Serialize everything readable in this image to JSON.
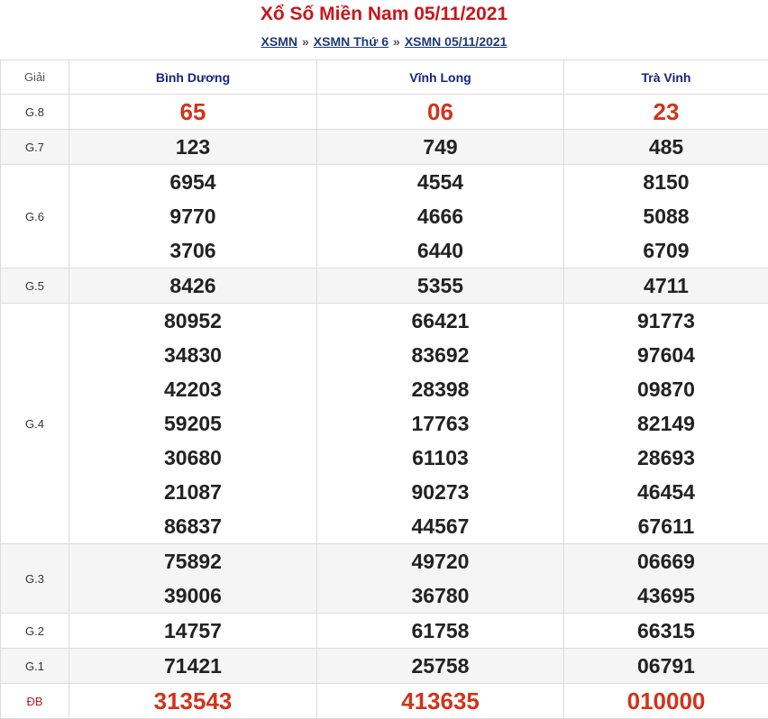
{
  "header": {
    "title": "Xổ Số Miền Nam 05/11/2021",
    "crumbs": [
      "XSMN",
      "XSMN Thứ 6",
      "XSMN 05/11/2021"
    ],
    "sep": "»"
  },
  "table": {
    "label_header": "Giải",
    "provinces": [
      "Bình Dương",
      "Vĩnh Long",
      "Trà Vinh"
    ],
    "rows": [
      {
        "label": "G.8",
        "values": [
          [
            "65"
          ],
          [
            "06"
          ],
          [
            "23"
          ]
        ]
      },
      {
        "label": "G.7",
        "values": [
          [
            "123"
          ],
          [
            "749"
          ],
          [
            "485"
          ]
        ]
      },
      {
        "label": "G.6",
        "values": [
          [
            "6954",
            "9770",
            "3706"
          ],
          [
            "4554",
            "4666",
            "6440"
          ],
          [
            "8150",
            "5088",
            "6709"
          ]
        ]
      },
      {
        "label": "G.5",
        "values": [
          [
            "8426"
          ],
          [
            "5355"
          ],
          [
            "4711"
          ]
        ]
      },
      {
        "label": "G.4",
        "values": [
          [
            "80952",
            "34830",
            "42203",
            "59205",
            "30680",
            "21087",
            "86837"
          ],
          [
            "66421",
            "83692",
            "28398",
            "17763",
            "61103",
            "90273",
            "44567"
          ],
          [
            "91773",
            "97604",
            "09870",
            "82149",
            "28693",
            "46454",
            "67611"
          ]
        ]
      },
      {
        "label": "G.3",
        "values": [
          [
            "75892",
            "39006"
          ],
          [
            "49720",
            "36780"
          ],
          [
            "06669",
            "43695"
          ]
        ]
      },
      {
        "label": "G.2",
        "values": [
          [
            "14757"
          ],
          [
            "61758"
          ],
          [
            "66315"
          ]
        ]
      },
      {
        "label": "G.1",
        "values": [
          [
            "71421"
          ],
          [
            "25758"
          ],
          [
            "06791"
          ]
        ]
      },
      {
        "label": "ĐB",
        "values": [
          [
            "313543"
          ],
          [
            "413635"
          ],
          [
            "010000"
          ]
        ]
      }
    ]
  }
}
